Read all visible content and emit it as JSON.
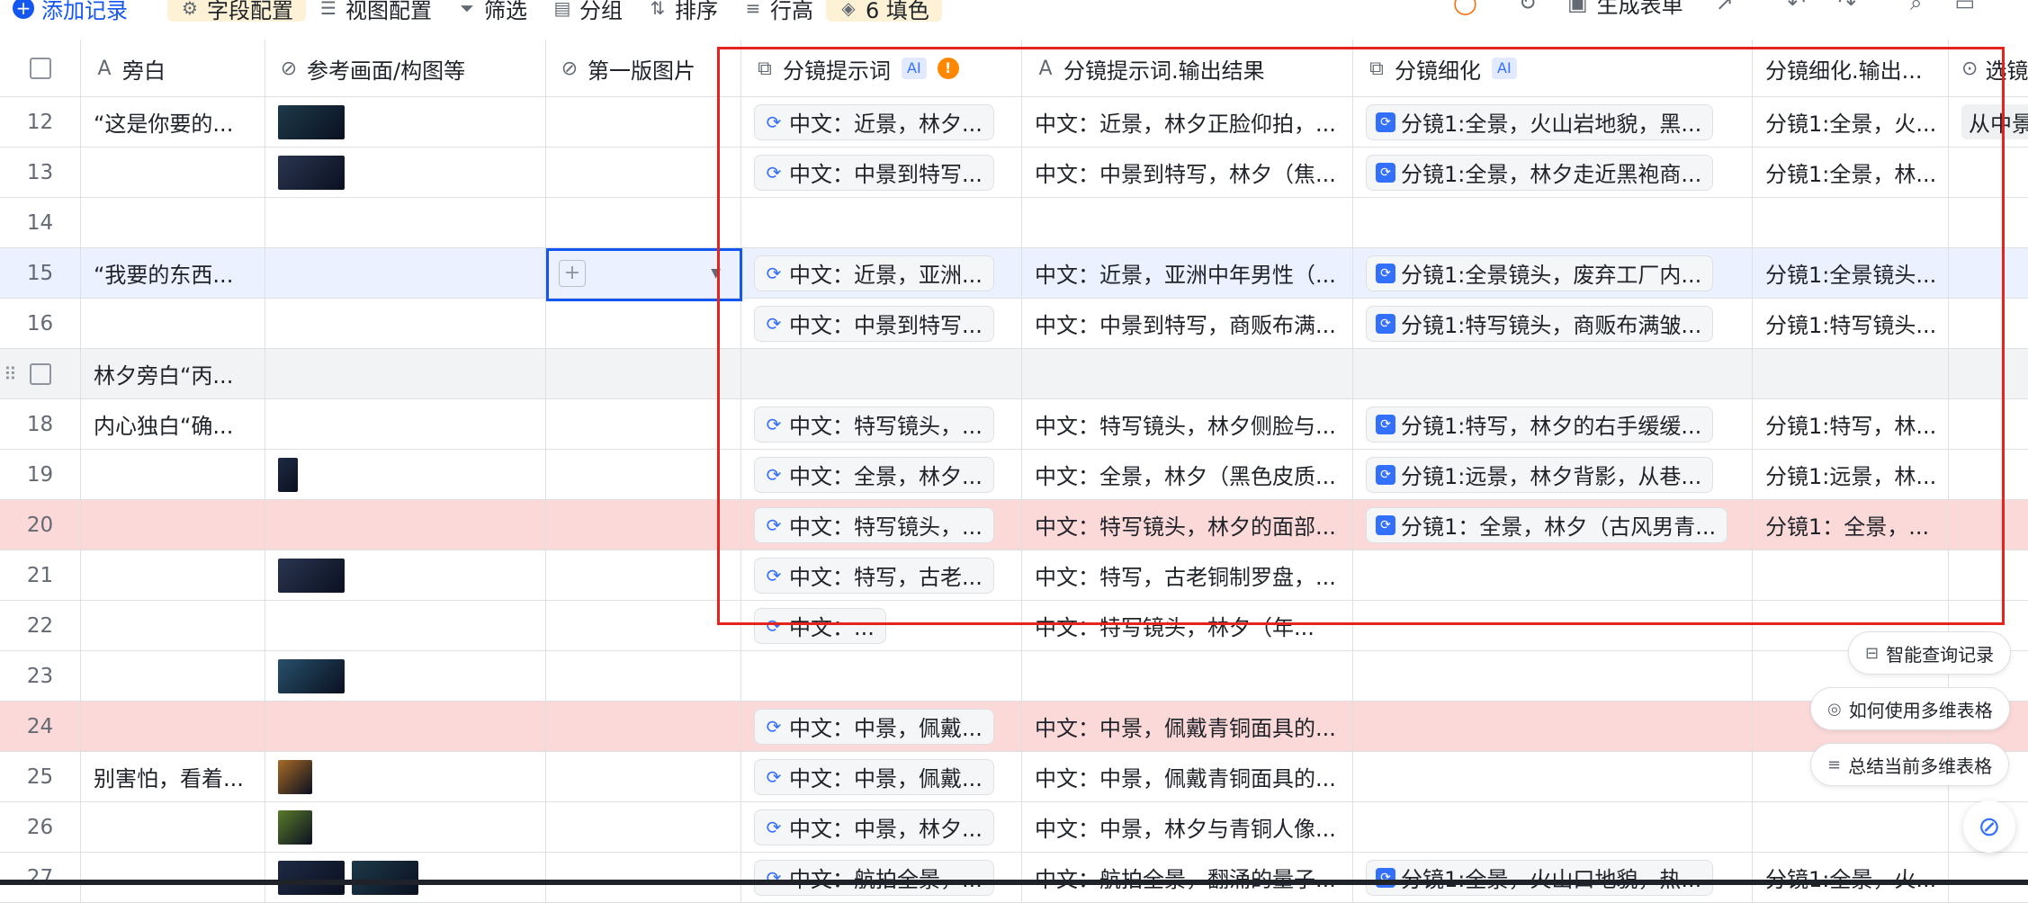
{
  "toolbar": {
    "add_record": "添加记录",
    "field_config": "字段配置",
    "view_config": "视图配置",
    "filter": "筛选",
    "group": "分组",
    "sort": "排序",
    "row_height": "行高",
    "fill_count": "6 填色",
    "generate_form": "生成表单"
  },
  "columns": [
    {
      "name": "旁白",
      "icon": "text-icon"
    },
    {
      "name": "参考画面/构图等",
      "icon": "attachment-icon"
    },
    {
      "name": "第一版图片",
      "icon": "attachment-icon"
    },
    {
      "name": "分镜提示词",
      "icon": "ai-field-icon",
      "ai": "AI",
      "warn": "!"
    },
    {
      "name": "分镜提示词.输出结果",
      "icon": "ai-text-icon"
    },
    {
      "name": "分镜细化",
      "icon": "ai-field-icon",
      "ai": "AI"
    },
    {
      "name": "分镜细化.输出...",
      "icon": ""
    },
    {
      "name": "选镜",
      "icon": "select-icon"
    }
  ],
  "rows": [
    {
      "num": "12",
      "narr": "“这是你要的...",
      "thumbs": 1,
      "p": "中文：近景，林夕...",
      "out": "中文：近景，林夕正脸仰拍，...",
      "ref": "分镜1:全景，火山岩地貌，黑...",
      "refout": "分镜1:全景，火...",
      "last": "从中景"
    },
    {
      "num": "13",
      "narr": "",
      "thumbs": 1,
      "p": "中文：中景到特写...",
      "out": "中文：中景到特写，林夕（焦...",
      "ref": "分镜1:全景，林夕走近黑袍商...",
      "refout": "分镜1:全景，林...",
      "last": ""
    },
    {
      "num": "14",
      "narr": "",
      "thumbs": 0,
      "p": "",
      "out": "",
      "ref": "",
      "refout": "",
      "last": ""
    },
    {
      "num": "15",
      "narr": "“我要的东西...",
      "thumbs": 0,
      "p": "中文：近景，亚洲...",
      "out": "中文：近景，亚洲中年男性（...",
      "ref": "分镜1:全景镜头，废弃工厂内...",
      "refout": "分镜1:全景镜头...",
      "last": ""
    },
    {
      "num": "16",
      "narr": "",
      "thumbs": 0,
      "p": "中文：中景到特写...",
      "out": "中文：中景到特写，商贩布满...",
      "ref": "分镜1:特写镜头，商贩布满皱...",
      "refout": "分镜1:特写镜头...",
      "last": ""
    },
    {
      "num": "",
      "narr": "林夕旁白“丙...",
      "thumbs": 0,
      "p": "",
      "out": "",
      "ref": "",
      "refout": "",
      "last": ""
    },
    {
      "num": "18",
      "narr": "内心独白“确...",
      "thumbs": 0,
      "p": "中文：特写镜头，...",
      "out": "中文：特写镜头，林夕侧脸与...",
      "ref": "分镜1:特写，林夕的右手缓缓...",
      "refout": "分镜1:特写，林...",
      "last": ""
    },
    {
      "num": "19",
      "narr": "",
      "thumbs": 1,
      "p": "中文：全景，林夕...",
      "out": "中文：全景，林夕（黑色皮质...",
      "ref": "分镜1:远景，林夕背影，从巷...",
      "refout": "分镜1:远景，林...",
      "last": ""
    },
    {
      "num": "20",
      "narr": "",
      "thumbs": 0,
      "p": "中文：特写镜头，...",
      "out": "中文：特写镜头，林夕的面部...",
      "ref": "分镜1：全景，林夕（古风男青...",
      "refout": "分镜1：全景，...",
      "last": ""
    },
    {
      "num": "21",
      "narr": "",
      "thumbs": 1,
      "p": "中文：特写，古老...",
      "out": "中文：特写，古老铜制罗盘，...",
      "ref": "",
      "refout": "",
      "last": ""
    },
    {
      "num": "22",
      "narr": "",
      "thumbs": 0,
      "p": "中文：...",
      "out": "中文：特写镜头，林夕（年...",
      "ref": "",
      "refout": "",
      "last": ""
    },
    {
      "num": "23",
      "narr": "",
      "thumbs": 1,
      "p": "",
      "out": "",
      "ref": "",
      "refout": "",
      "last": ""
    },
    {
      "num": "24",
      "narr": "",
      "thumbs": 0,
      "p": "中文：中景，佩戴...",
      "out": "中文：中景，佩戴青铜面具的...",
      "ref": "",
      "refout": "",
      "last": ""
    },
    {
      "num": "25",
      "narr": "别害怕，看着...",
      "thumbs": 1,
      "p": "中文：中景，佩戴...",
      "out": "中文：中景，佩戴青铜面具的...",
      "ref": "",
      "refout": "",
      "last": ""
    },
    {
      "num": "26",
      "narr": "",
      "thumbs": 1,
      "p": "中文：中景，林夕...",
      "out": "中文：中景，林夕与青铜人像...",
      "ref": "",
      "refout": "",
      "last": ""
    },
    {
      "num": "27",
      "narr": "",
      "thumbs": 2,
      "p": "中文：航拍全景，...",
      "out": "中文：航拍全景，翻涌的量子...",
      "ref": "分镜1:全景，火山口地貌，热...",
      "refout": "分镜1:全景，火...",
      "last": ""
    }
  ],
  "floating": {
    "smart_query": "智能查询记录",
    "how_to_use": "如何使用多维表格",
    "summarize": "总结当前多维表格"
  },
  "colors": {
    "highlight_box": "#e5231f",
    "selection": "#1456f0",
    "pink_row": "#fcd9d9",
    "selected_row": "#ebf1ff"
  }
}
